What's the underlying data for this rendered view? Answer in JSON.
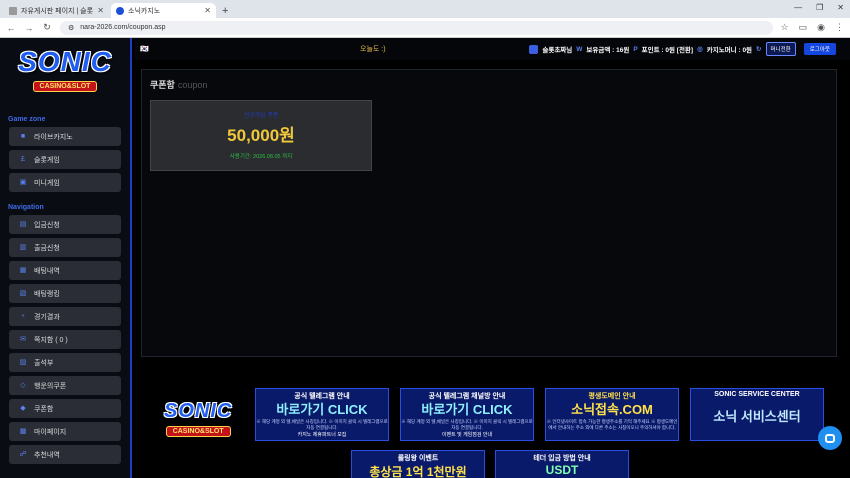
{
  "browser": {
    "tabs": [
      {
        "title": "자유게시판 페이지 | 슬롯나라"
      },
      {
        "title": "소닉카지노"
      }
    ],
    "url": "nara-2026.com/coupon.asp"
  },
  "sidebar": {
    "logo": {
      "main": "SONIC",
      "sub": "CASINO&SLOT"
    },
    "game_zone_label": "Game zone",
    "game_items": [
      {
        "label": "라이브카지노",
        "icon": "casino-icon"
      },
      {
        "label": "슬롯게임",
        "icon": "slot-icon"
      },
      {
        "label": "미니게임",
        "icon": "mini-icon"
      }
    ],
    "navigation_label": "Navigation",
    "nav_items": [
      {
        "label": "입금신청",
        "icon": "deposit-icon"
      },
      {
        "label": "출금신청",
        "icon": "withdraw-icon"
      },
      {
        "label": "배팅내역",
        "icon": "history-icon"
      },
      {
        "label": "배팅랭킹",
        "icon": "ranking-icon"
      },
      {
        "label": "경기결과",
        "icon": "result-icon"
      },
      {
        "label": "쪽지함 ( 0 )",
        "icon": "message-icon"
      },
      {
        "label": "출석부",
        "icon": "attendance-icon"
      },
      {
        "label": "행운의쿠폰",
        "icon": "coupon-icon"
      },
      {
        "label": "쿠폰함",
        "icon": "coupon-box-icon"
      },
      {
        "label": "마이페이지",
        "icon": "mypage-icon"
      },
      {
        "label": "추천내역",
        "icon": "recommend-icon"
      }
    ]
  },
  "topbar": {
    "today_label": "오늘도 :)",
    "username": "슬롯초짜님",
    "balance_label": "보유금액 : 16원",
    "point_label": "포인트 : 0원 [전환]",
    "casino_money_label": "카지노머니 : 0원",
    "money_convert_btn": "머니전환",
    "logout_btn": "로그아웃"
  },
  "coupon_panel": {
    "title": "쿠폰함",
    "subtitle": "coupon",
    "card": {
      "label": "신규가입 쿠폰",
      "amount": "50,000원",
      "expiry": "사용기간: 2026.08.05 까지"
    }
  },
  "banners": {
    "logo": {
      "main": "SONIC",
      "sub": "CASINO&SLOT"
    },
    "row1": [
      {
        "title": "공식 텔레그램 안내",
        "big": "바로가기 CLICK",
        "note": "※ 해당 계정 외 텔,채널은 사칭입니다. ※ 이미지 클릭 시 텔레그램으로 자동 연결됩니다.",
        "foot": "카지노 제휴파트너 모집"
      },
      {
        "title": "공식 텔레그램 채널방 안내",
        "big": "바로가기 CLICK",
        "note": "※ 해당 계정 외 텔,채널은 사칭입니다. ※ 이미지 클릭 시 텔레그램으로 자동 연결됩니다.",
        "foot": "이벤트 및 게임점검 안내"
      },
      {
        "title": "평생도메인 안내",
        "big": "소닉접속.COM",
        "note": "※ 인터넷사이트 접속 가능한 평생주소를 기억 해주세요 ※ 평생도메인에서 안내하는 주소 외에 다른 주소는 사칭이오니 주의하셔야 합니다.",
        "foot": ""
      },
      {
        "title": "SONIC SERVICE CENTER",
        "big": "소닉 서비스센터",
        "note": "",
        "foot": ""
      }
    ],
    "row2": [
      {
        "title": "롤링왕 이벤트",
        "big": "총상금 1억 1천만원"
      },
      {
        "title": "테더 입금 방법 안내",
        "big": "USDT"
      }
    ]
  }
}
